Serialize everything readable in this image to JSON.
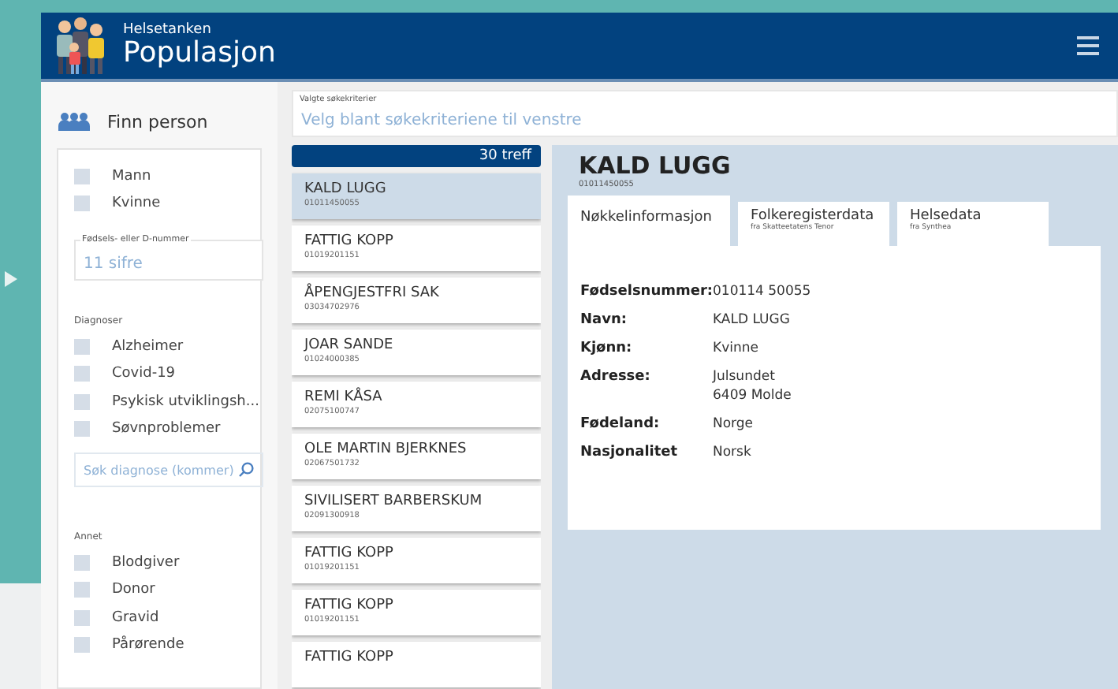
{
  "header": {
    "subtitle": "Helsetanken",
    "title": "Populasjon"
  },
  "sidebar": {
    "title": "Finn person",
    "gender": [
      {
        "label": "Mann",
        "checked": false
      },
      {
        "label": "Kvinne",
        "checked": false
      }
    ],
    "id_field": {
      "label": "Fødsels- eller D-nummer",
      "placeholder": "11 sifre"
    },
    "diagnoses": {
      "label": "Diagnoser",
      "items": [
        {
          "label": "Alzheimer",
          "checked": false
        },
        {
          "label": "Covid-19",
          "checked": false
        },
        {
          "label": "Psykisk utviklingsh...",
          "checked": false
        },
        {
          "label": "Søvnproblemer",
          "checked": false
        }
      ],
      "search": {
        "placeholder": "Søk diagnose (kommer)"
      }
    },
    "other": {
      "label": "Annet",
      "items": [
        {
          "label": "Blodgiver",
          "checked": false
        },
        {
          "label": "Donor",
          "checked": false
        },
        {
          "label": "Gravid",
          "checked": false
        },
        {
          "label": "Pårørende",
          "checked": false
        }
      ]
    }
  },
  "criteria": {
    "label": "Valgte søkekriterier",
    "placeholder": "Velg blant søkekriteriene til venstre"
  },
  "results": {
    "count": "30 treff",
    "items": [
      {
        "name": "KALD LUGG",
        "id": "01011450055",
        "selected": true
      },
      {
        "name": "FATTIG KOPP",
        "id": "01019201151",
        "selected": false
      },
      {
        "name": "ÅPENGJESTFRI SAK",
        "id": "03034702976",
        "selected": false
      },
      {
        "name": "JOAR SANDE",
        "id": "01024000385",
        "selected": false
      },
      {
        "name": "REMI KÅSA",
        "id": "02075100747",
        "selected": false
      },
      {
        "name": "OLE MARTIN BJERKNES",
        "id": "02067501732",
        "selected": false
      },
      {
        "name": "SIVILISERT BARBERSKUM",
        "id": "02091300918",
        "selected": false
      },
      {
        "name": "FATTIG KOPP",
        "id": "01019201151",
        "selected": false
      },
      {
        "name": "FATTIG KOPP",
        "id": "01019201151",
        "selected": false
      },
      {
        "name": "FATTIG KOPP",
        "selected": false
      }
    ]
  },
  "detail": {
    "name": "KALD LUGG",
    "id": "01011450055",
    "tabs": [
      {
        "label": "Nøkkelinformasjon",
        "selected": true
      },
      {
        "label": "Folkeregisterdata",
        "sublabel": "fra Skatteetatens Tenor",
        "selected": false
      },
      {
        "label": "Helsedata",
        "sublabel": "fra Synthea",
        "selected": false
      }
    ],
    "fields": [
      {
        "label": "Fødselsnummer:",
        "value": [
          "010114 50055"
        ]
      },
      {
        "label": "Navn:",
        "value": [
          "KALD LUGG"
        ]
      },
      {
        "label": "Kjønn:",
        "value": [
          "Kvinne"
        ]
      },
      {
        "label": "Adresse:",
        "value": [
          "Julsundet",
          "6409 Molde"
        ]
      },
      {
        "label": "Fødeland:",
        "value": [
          "Norge"
        ]
      },
      {
        "label": "Nasjonalitet",
        "value": [
          "Norsk"
        ]
      }
    ]
  }
}
